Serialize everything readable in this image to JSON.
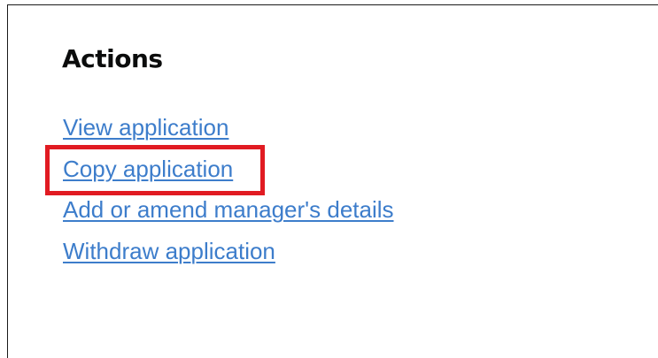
{
  "section": {
    "heading": "Actions"
  },
  "actions": [
    {
      "label": "View application"
    },
    {
      "label": "Copy application"
    },
    {
      "label": "Add or amend manager's details"
    },
    {
      "label": "Withdraw application"
    }
  ],
  "highlight": {
    "target": "Copy application",
    "color": "#e11b22"
  },
  "colors": {
    "link": "#3d7dcb",
    "heading": "#0b0c0c",
    "border": "#1a1a1a"
  }
}
